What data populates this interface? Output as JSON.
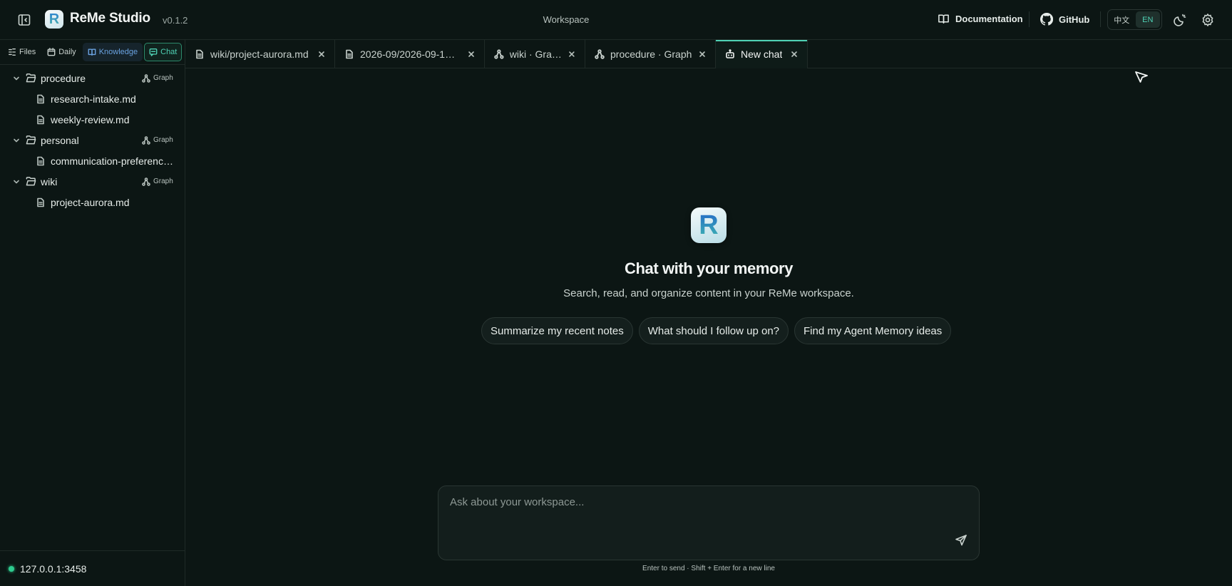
{
  "header": {
    "app_title": "ReMe Studio",
    "logo_letter": "R",
    "version": "v0.1.2",
    "workspace": "Workspace",
    "documentation": "Documentation",
    "github": "GitHub",
    "lang_zh": "中文",
    "lang_en": "EN",
    "active_lang": "EN"
  },
  "sidebar": {
    "tabs": [
      {
        "label": "Files",
        "icon": "files-icon"
      },
      {
        "label": "Daily",
        "icon": "calendar-icon"
      },
      {
        "label": "Knowledge",
        "icon": "book-icon"
      },
      {
        "label": "Chat",
        "icon": "chat-icon"
      }
    ],
    "graph_label": "Graph",
    "folders": [
      {
        "name": "procedure",
        "files": [
          "research-intake.md",
          "weekly-review.md"
        ]
      },
      {
        "name": "personal",
        "files": [
          "communication-preferences.md"
        ]
      },
      {
        "name": "wiki",
        "files": [
          "project-aurora.md"
        ]
      }
    ],
    "server": "127.0.0.1:3458"
  },
  "tabs": [
    {
      "label": "wiki/project-aurora.md",
      "icon": "file-icon",
      "active": false
    },
    {
      "label": "2026-09/2026-09-1…",
      "icon": "file-icon",
      "active": false
    },
    {
      "label": "wiki · Graph",
      "icon": "graph-icon",
      "active": false
    },
    {
      "label": "procedure · Graph",
      "icon": "graph-icon",
      "active": false
    },
    {
      "label": "New chat",
      "icon": "bot-icon",
      "active": true
    }
  ],
  "chat": {
    "logo_letter": "R",
    "title": "Chat with your memory",
    "subtitle": "Search, read, and organize content in your ReMe workspace.",
    "suggestions": [
      "Summarize my recent notes",
      "What should I follow up on?",
      "Find my Agent Memory ideas"
    ],
    "input_placeholder": "Ask about your workspace...",
    "hint": "Enter to send · Shift + Enter for a new line"
  },
  "colors": {
    "background": "#0c1614",
    "accent": "#4fd1b4",
    "knowledge_tab": "#6aa2e0",
    "status_online": "#2ecc8f"
  }
}
